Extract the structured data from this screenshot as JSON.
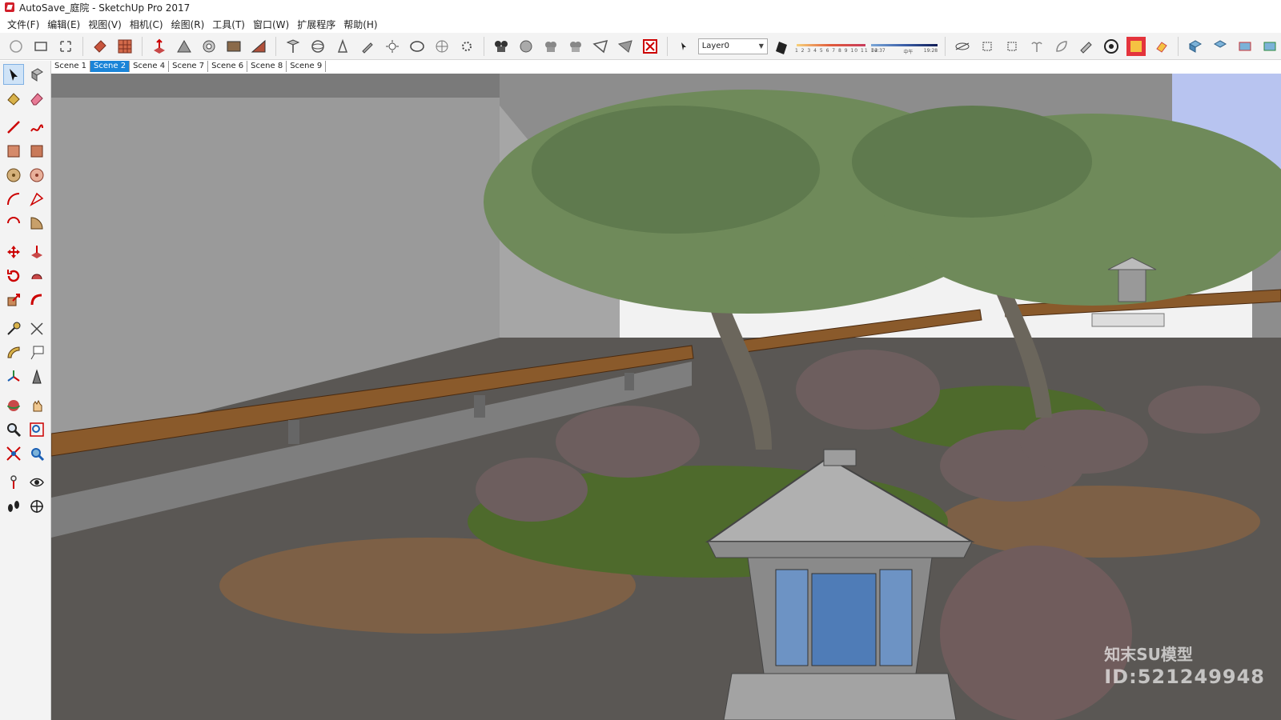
{
  "window": {
    "title": "AutoSave_庭院 - SketchUp Pro 2017"
  },
  "menu": {
    "items": [
      {
        "label": "文件(F)"
      },
      {
        "label": "编辑(E)"
      },
      {
        "label": "视图(V)"
      },
      {
        "label": "相机(C)"
      },
      {
        "label": "绘图(R)"
      },
      {
        "label": "工具(T)"
      },
      {
        "label": "窗口(W)"
      },
      {
        "label": "扩展程序"
      },
      {
        "label": "帮助(H)"
      }
    ]
  },
  "toolbar": {
    "layer_value": "Layer0",
    "shadow_ticks": "1 2 3 4 5 6 7 8 9 10 11 12",
    "time_start": "04:37",
    "time_mid": "中午",
    "time_end": "19:28"
  },
  "scenes": {
    "tabs": [
      {
        "label": "Scene 1",
        "active": false
      },
      {
        "label": "Scene 2",
        "active": true
      },
      {
        "label": "Scene 4",
        "active": false
      },
      {
        "label": "Scene 7",
        "active": false
      },
      {
        "label": "Scene 6",
        "active": false
      },
      {
        "label": "Scene 8",
        "active": false
      },
      {
        "label": "Scene 9",
        "active": false
      }
    ]
  },
  "watermark": {
    "brand": "知末SU模型",
    "id": "ID:521249948"
  },
  "colors": {
    "accent": "#1a84d8",
    "brand_red": "#d21f2a",
    "wall": "#9a9a9a",
    "ground": "#5a5754",
    "foliage": "#6f8a5a",
    "handrail": "#8a5a2b"
  }
}
